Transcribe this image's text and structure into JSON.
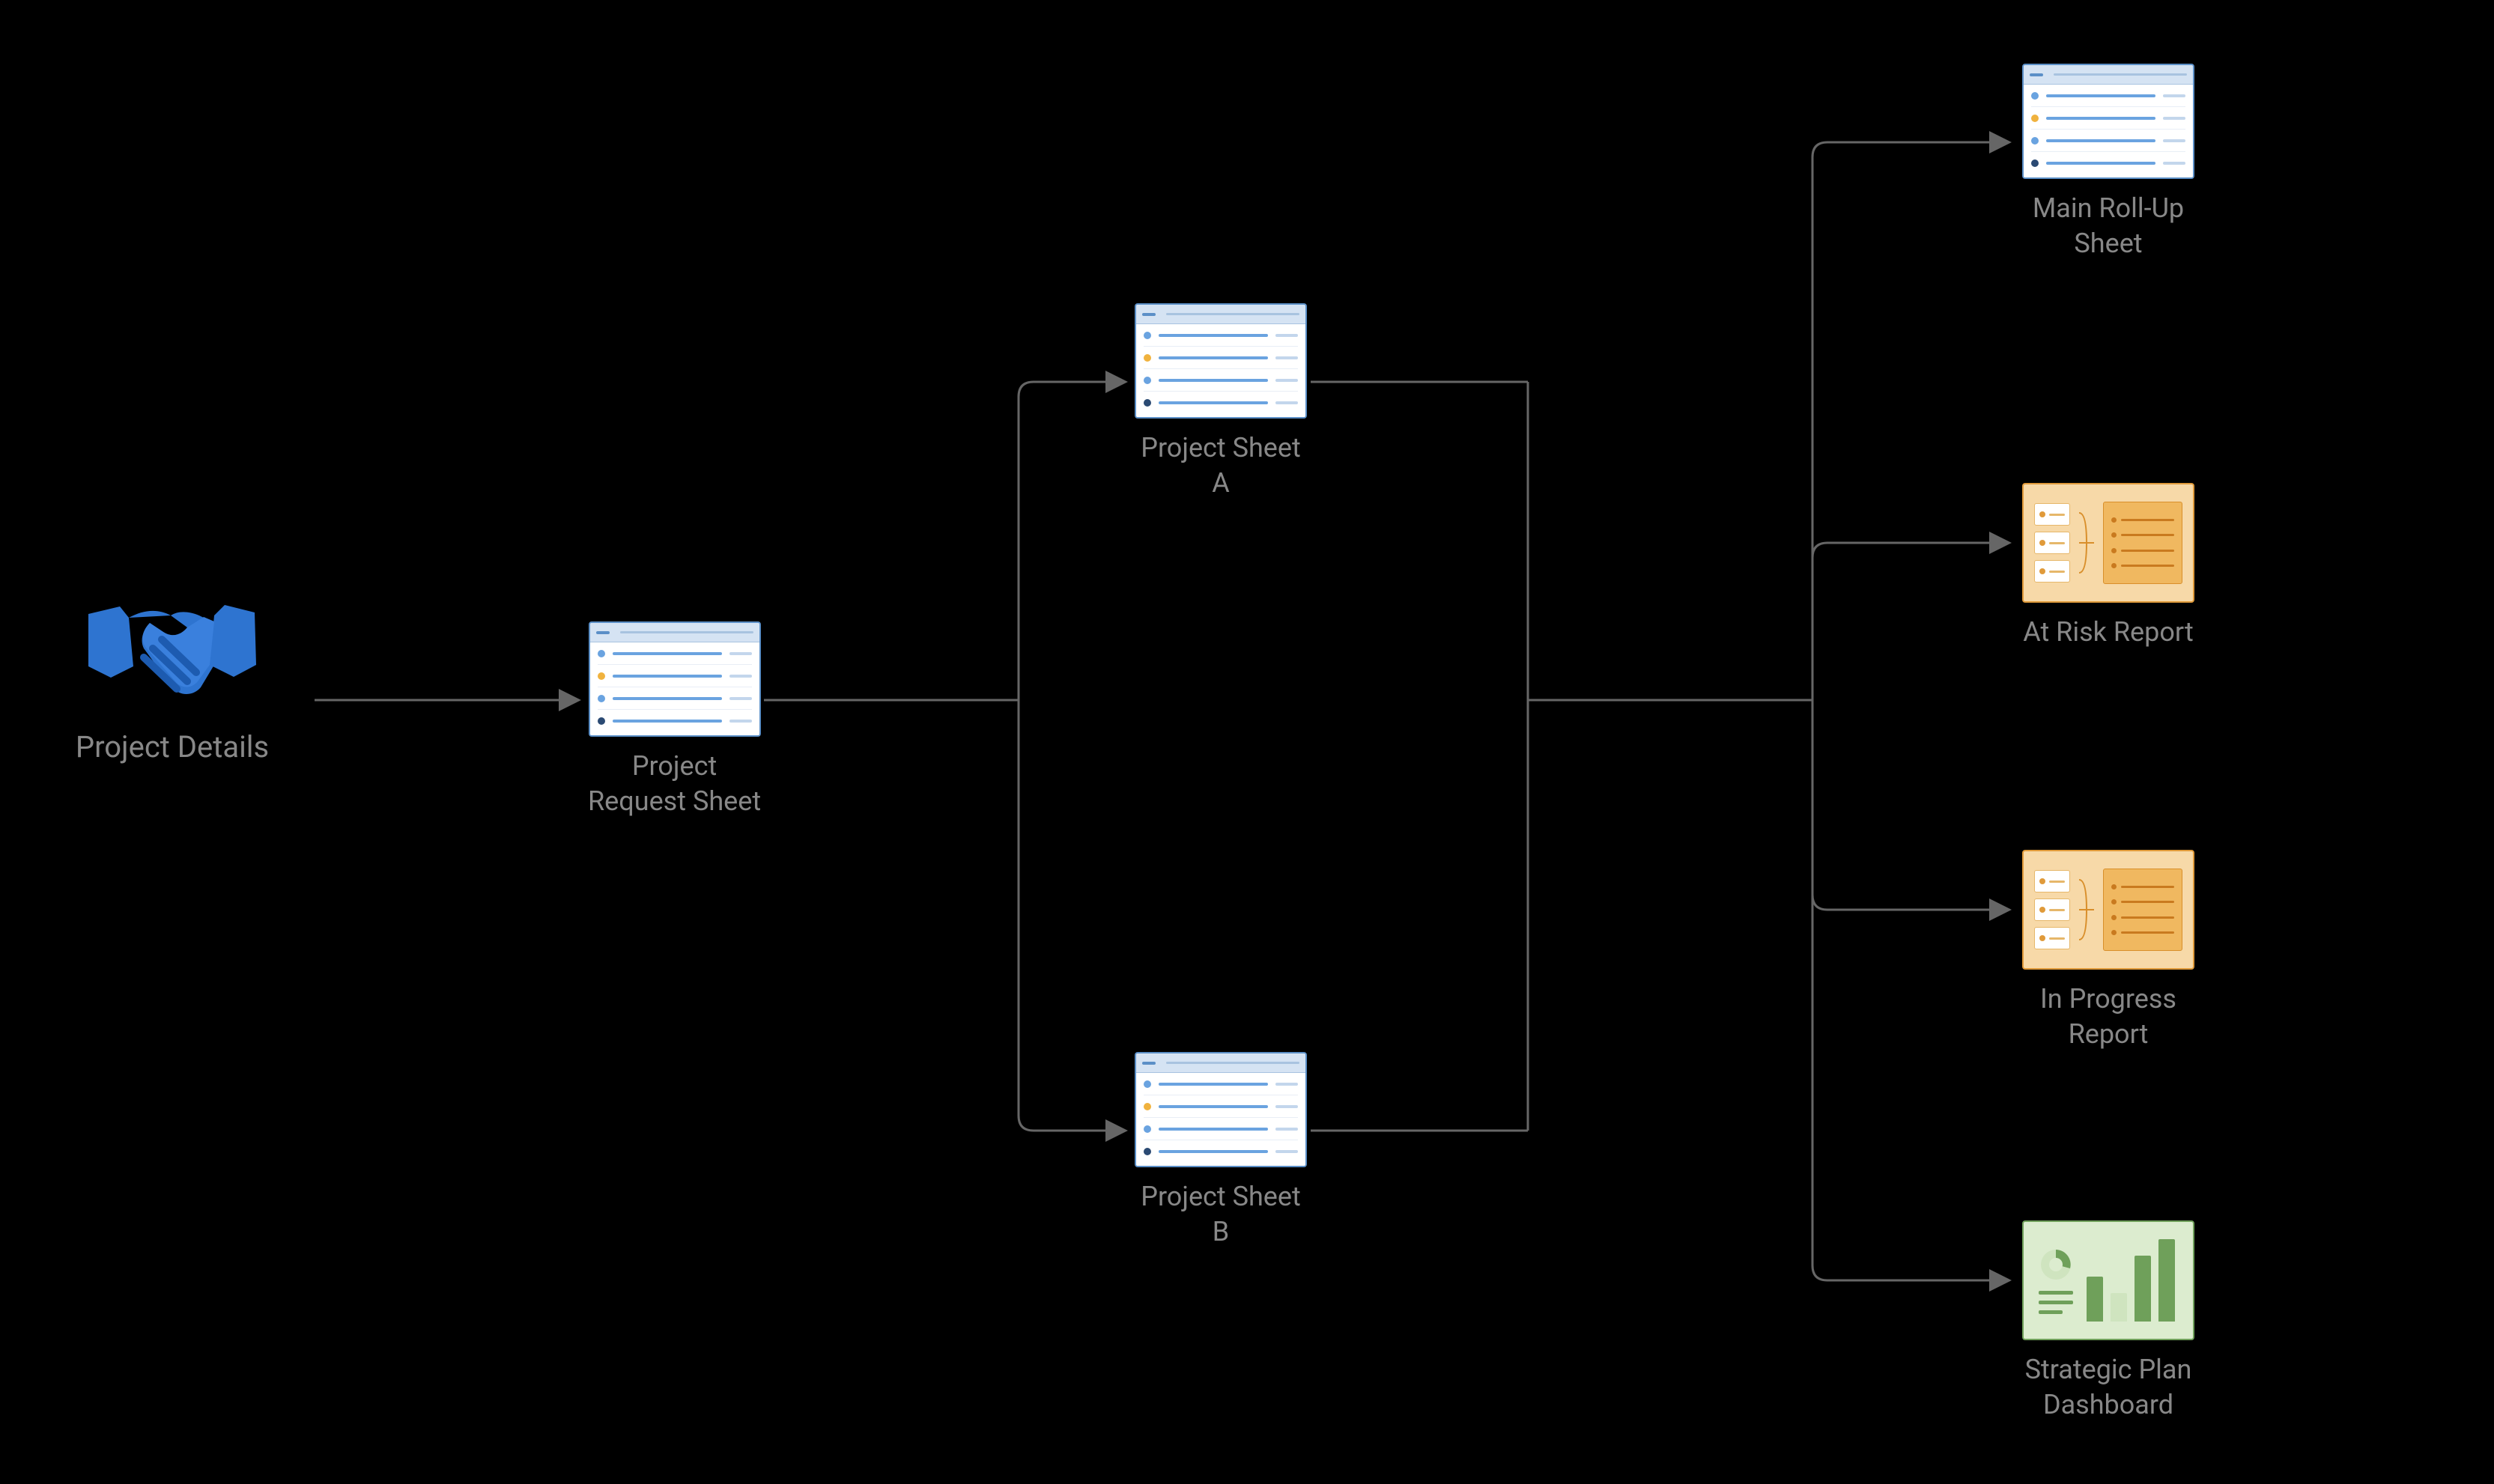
{
  "nodes": {
    "project_details": {
      "label": "Project Details"
    },
    "project_request_sheet": {
      "label_l1": "Project",
      "label_l2": "Request Sheet"
    },
    "project_sheet_a": {
      "label_l1": "Project Sheet",
      "label_l2": "A"
    },
    "project_sheet_b": {
      "label_l1": "Project Sheet",
      "label_l2": "B"
    },
    "main_rollup": {
      "label_l1": "Main Roll-Up",
      "label_l2": "Sheet"
    },
    "at_risk_report": {
      "label": "At Risk Report"
    },
    "in_progress_report": {
      "label_l1": "In Progress",
      "label_l2": "Report"
    },
    "strategic_dashboard": {
      "label_l1": "Strategic Plan",
      "label_l2": "Dashboard"
    }
  }
}
